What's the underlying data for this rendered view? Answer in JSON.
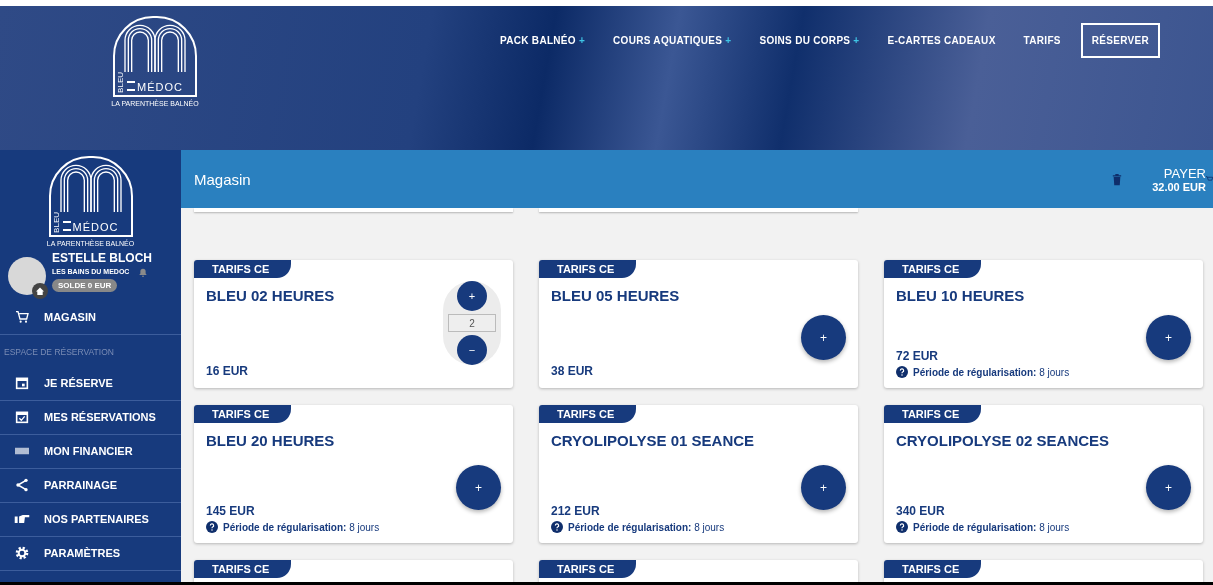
{
  "header": {
    "logo": {
      "word_vertical": "BLEU",
      "word": "MÉDOC",
      "tagline": "LA PARENTHÈSE BALNÉO"
    },
    "nav": [
      {
        "label": "PACK BALNÉO",
        "has_submenu": true,
        "kind": "link"
      },
      {
        "label": "COURS AQUATIQUES",
        "has_submenu": true,
        "kind": "link"
      },
      {
        "label": "SOINS DU CORPS",
        "has_submenu": true,
        "kind": "link"
      },
      {
        "label": "E-CARTES CADEAUX",
        "has_submenu": false,
        "kind": "link"
      },
      {
        "label": "TARIFS",
        "has_submenu": false,
        "kind": "link"
      },
      {
        "label": "RÉSERVER",
        "has_submenu": false,
        "kind": "outlined"
      }
    ],
    "submenu_mark": "+"
  },
  "sidebar": {
    "logo": {
      "word_vertical": "BLEU",
      "word": "MÉDOC",
      "tagline": "LA PARENTHÈSE BALNÉO"
    },
    "profile": {
      "name": "ESTELLE BLOCH",
      "site": "LES BAINS DU MEDOC",
      "balance": "SOLDE 0 EUR"
    },
    "items": [
      {
        "kind": "item",
        "label": "MAGASIN"
      },
      {
        "kind": "section",
        "label": "ESPACE DE RÉSERVATION"
      },
      {
        "kind": "item",
        "label": "JE RÉSERVE"
      },
      {
        "kind": "item",
        "label": "MES RÉSERVATIONS"
      },
      {
        "kind": "item",
        "label": "MON FINANCIER"
      },
      {
        "kind": "item",
        "label": "PARRAINAGE"
      },
      {
        "kind": "item",
        "label": "NOS PARTENAIRES"
      },
      {
        "kind": "item",
        "label": "PARAMÈTRES"
      }
    ]
  },
  "app_bar": {
    "title": "Magasin",
    "pay_label": "PAYER",
    "total": "32.00 EUR"
  },
  "products": [
    {
      "tag": "TARIFS CE",
      "name": "BLEU 02 HEURES",
      "price": "16 EUR",
      "quantity": "2",
      "plus": "+",
      "minus": "−"
    },
    {
      "tag": "TARIFS CE",
      "name": "BLEU 05 HEURES",
      "price": "38 EUR",
      "plus": "+"
    },
    {
      "tag": "TARIFS CE",
      "name": "BLEU 10 HEURES",
      "price": "72 EUR",
      "note": "**Période de régularisation:** 8 jours",
      "plus": "+"
    },
    {
      "tag": "TARIFS CE",
      "name": "BLEU 20 HEURES",
      "price": "145 EUR",
      "note": "**Période de régularisation:** 8 jours",
      "plus": "+"
    },
    {
      "tag": "TARIFS CE",
      "name": "CRYOLIPOLYSE 01 SEANCE",
      "price": "212 EUR",
      "note": "**Période de régularisation:** 8 jours",
      "plus": "+"
    },
    {
      "tag": "TARIFS CE",
      "name": "CRYOLIPOLYSE 02 SEANCES",
      "price": "340 EUR",
      "note": "**Période de régularisation:** 8 jours",
      "plus": "+"
    },
    {
      "tag": "TARIFS CE"
    },
    {
      "tag": "TARIFS CE"
    },
    {
      "tag": "TARIFS CE"
    }
  ]
}
